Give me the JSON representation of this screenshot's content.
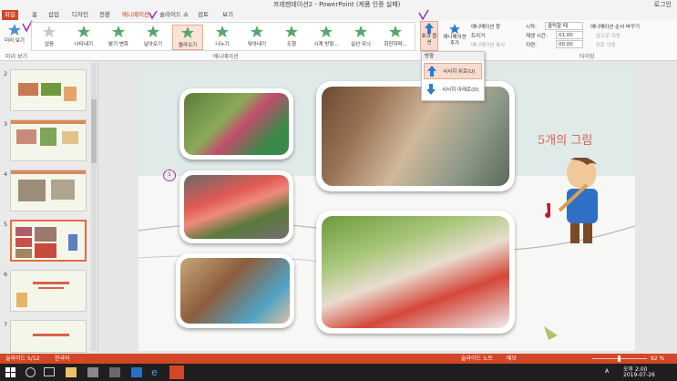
{
  "window": {
    "title": "프레젠테이션2 - PowerPoint (제품 인증 실패)",
    "login": "로그인"
  },
  "tabs": [
    "파일",
    "홈",
    "삽입",
    "디자인",
    "전환",
    "애니메이션",
    "슬라이드 쇼",
    "검토",
    "보기"
  ],
  "ribbon": {
    "preview_label": "미리 보기",
    "preview_group": "미리 보기",
    "animation_group": "애니메이션",
    "timing_group": "타이밍",
    "animations": [
      "없음",
      "나타내기",
      "밝기 변화",
      "날아오기",
      "올라오기",
      "나누기",
      "닦아내기",
      "도형",
      "시계 방향...",
      "실선 무늬",
      "회전하며..."
    ],
    "selected_animation": "올라오기",
    "effect_options_label": "효과 옵션",
    "add_animation_label": "애니메이션 추가",
    "animation_pane": "애니메이션 창",
    "trigger": "트리거",
    "animation_painter": "애니메이션 복사",
    "start_label": "시작:",
    "start_value": "클릭할 때",
    "duration_label": "재생 시간:",
    "duration_value": "01.00",
    "delay_label": "지연:",
    "delay_value": "00.00",
    "reorder_label": "애니메이션 순서 바꾸기",
    "move_earlier": "앞으로 이동",
    "move_later": "뒤로 이동"
  },
  "dropdown": {
    "header": "방향",
    "items": [
      "서서히 위로(U)",
      "서서히 아래로(D)"
    ]
  },
  "thumbnails": [
    {
      "num": "2",
      "selected": false
    },
    {
      "num": "3",
      "selected": false
    },
    {
      "num": "4",
      "selected": false
    },
    {
      "num": "5",
      "selected": true
    },
    {
      "num": "6",
      "selected": false
    },
    {
      "num": "7",
      "selected": false
    }
  ],
  "slide": {
    "title": "5개의 그림",
    "anim_marker": "1"
  },
  "status": {
    "slide_info": "슬라이드 5/12",
    "language": "한국어",
    "notes": "슬라이드 노트",
    "comments": "메모",
    "zoom": "92 %"
  },
  "taskbar": {
    "time": "오후 2:00",
    "date": "2019-07-26",
    "ime": "A"
  },
  "colors": {
    "accent": "#d24726",
    "ribbon_green": "#56a86d",
    "title_orange": "#d9624a"
  }
}
